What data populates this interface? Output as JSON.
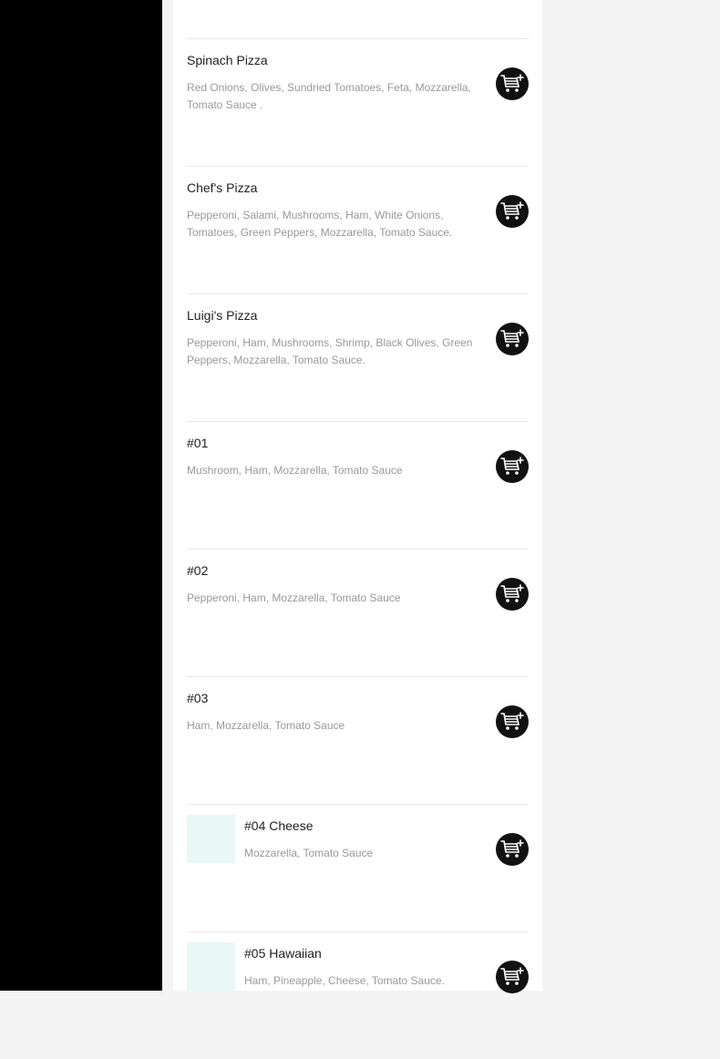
{
  "menu": {
    "items": [
      {
        "name": "",
        "description": ""
      },
      {
        "name": "Spinach Pizza",
        "description": "Red Onions, Olives, Sundried Tomatoes, Feta, Mozzarella, Tomato Sauce ."
      },
      {
        "name": "Chef's Pizza",
        "description": "Pepperoni, Salami, Mushrooms, Ham, White Onions, Tomatoes, Green Peppers, Mozzarella, Tomato Sauce."
      },
      {
        "name": "Luigi's Pizza",
        "description": "Pepperoni, Ham, Mushrooms, Shrimp, Black Olives, Green Peppers, Mozzarella, Tomato Sauce."
      },
      {
        "name": "#01",
        "description": "Mushroom, Ham, Mozzarella, Tomato Sauce"
      },
      {
        "name": "#02",
        "description": "Pepperoni, Ham, Mozzarella, Tomato Sauce"
      },
      {
        "name": "#03",
        "description": "Ham, Mozzarella, Tomato Sauce"
      },
      {
        "name": "#04 Cheese",
        "description": "Mozzarella, Tomato Sauce"
      },
      {
        "name": "#05 Hawaiian",
        "description": "Ham, Pineapple, Cheese, Tomato Sauce."
      }
    ]
  },
  "icons": {
    "add_to_cart": "cart-plus-icon",
    "item_image": "food-thumbnail"
  },
  "colors": {
    "sidebar": "#000000",
    "cart_button": "#111111",
    "description_text": "#999999",
    "name_text": "#222222",
    "thumbnail_placeholder": "#e9f8f4"
  }
}
